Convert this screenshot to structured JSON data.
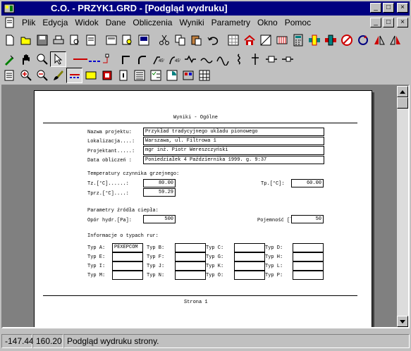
{
  "window": {
    "title": "C.O. - PRZYK1.GRD - [Podgląd wydruku]",
    "minimize": "_",
    "maximize": "□",
    "close": "×"
  },
  "menu": [
    "Plik",
    "Edycja",
    "Widok",
    "Dane",
    "Obliczenia",
    "Wyniki",
    "Parametry",
    "Okno",
    "Pomoc"
  ],
  "document": {
    "heading": "Wyniki - Ogólne",
    "project_rows": [
      {
        "label": "Nazwa projektu:",
        "value": "Przykład tradycyjnego układu pionowego"
      },
      {
        "label": "Lokalizacja....:",
        "value": "Warszawa, ul. Filtrowa 1"
      },
      {
        "label": "Projektant.....:",
        "value": "mgr inż. Piotr Wereszczyński"
      },
      {
        "label": "Data obliczeń :",
        "value": "Poniedziałek 4 Października 1999. g. 9:37"
      }
    ],
    "temp_heading": "Temperatury czynnika grzejnego:",
    "tz_label": "Tz.[°C]......:",
    "tz_value": "80.00",
    "tp_label": "Tp.[°C]:",
    "tp_value": "60.00",
    "tprz_label": "Tprz.[°C]....:",
    "tprz_value": "59.29",
    "source_heading": "Parametry źródła ciepła:",
    "opor_label": "Opór hydr.[Pa]:",
    "opor_value": "500",
    "poj_label": "Pojemność [l]:",
    "poj_value": "50",
    "pipes_heading": "Informacje o typach rur:",
    "pipe_types": [
      [
        "Typ A:",
        "Typ B:",
        "Typ C:",
        "Typ D:"
      ],
      [
        "Typ E:",
        "Typ F:",
        "Typ G:",
        "Typ H:"
      ],
      [
        "Typ I:",
        "Typ J:",
        "Typ K:",
        "Typ L:"
      ],
      [
        "Typ M:",
        "Typ N:",
        "Typ O:",
        "Typ P:"
      ]
    ],
    "pipe_a_value": "PEXEPCOM",
    "footer": "Strona 1"
  },
  "status": {
    "x": "-147.44",
    "y": "160.20",
    "message": "Podgląd wydruku strony."
  }
}
